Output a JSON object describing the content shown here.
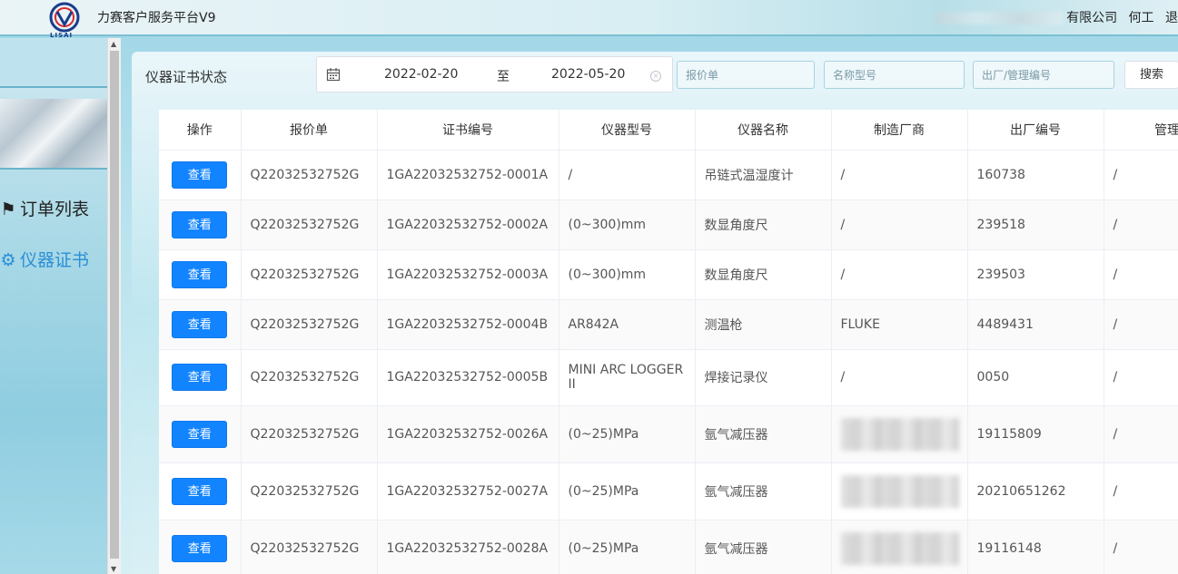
{
  "header": {
    "app_title": "力赛客户服务平台V9",
    "logo_text": "LISAI",
    "company_tail": "有限公司",
    "user": "何工",
    "extra": "退"
  },
  "sidebar": {
    "items": [
      {
        "label": "订单列表",
        "icon": "flag-icon"
      },
      {
        "label": "仪器证书",
        "icon": "gear-icon",
        "active": true
      }
    ]
  },
  "main": {
    "title": "仪器证书状态",
    "date_start": "2022-02-20",
    "date_sep": "至",
    "date_end": "2022-05-20",
    "filters": {
      "quote_placeholder": "报价单",
      "name_placeholder": "名称型号",
      "serial_placeholder": "出厂/管理编号"
    },
    "search_label": "搜索"
  },
  "table": {
    "columns": [
      "操作",
      "报价单",
      "证书编号",
      "仪器型号",
      "仪器名称",
      "制造厂商",
      "出厂编号",
      "管理"
    ],
    "view_label": "查看",
    "rows": [
      {
        "quote": "Q22032532752G",
        "cert": "1GA22032532752-0001A",
        "model": "/",
        "name": "吊链式温湿度计",
        "maker": "/",
        "serial": "160738",
        "mgmt": "/"
      },
      {
        "quote": "Q22032532752G",
        "cert": "1GA22032532752-0002A",
        "model": "(0~300)mm",
        "name": "数显角度尺",
        "maker": "/",
        "serial": "239518",
        "mgmt": "/"
      },
      {
        "quote": "Q22032532752G",
        "cert": "1GA22032532752-0003A",
        "model": "(0~300)mm",
        "name": "数显角度尺",
        "maker": "/",
        "serial": "239503",
        "mgmt": "/"
      },
      {
        "quote": "Q22032532752G",
        "cert": "1GA22032532752-0004B",
        "model": "AR842A",
        "name": "测温枪",
        "maker": "FLUKE",
        "serial": "4489431",
        "mgmt": "/"
      },
      {
        "quote": "Q22032532752G",
        "cert": "1GA22032532752-0005B",
        "model": "MINI ARC LOGGER II",
        "name": "焊接记录仪",
        "maker": "/",
        "serial": "0050",
        "mgmt": "/"
      },
      {
        "quote": "Q22032532752G",
        "cert": "1GA22032532752-0026A",
        "model": "(0~25)MPa",
        "name": "氩气减压器",
        "maker": "",
        "serial": "19115809",
        "mgmt": "/"
      },
      {
        "quote": "Q22032532752G",
        "cert": "1GA22032532752-0027A",
        "model": "(0~25)MPa",
        "name": "氩气减压器",
        "maker": "",
        "serial": "20210651262",
        "mgmt": "/"
      },
      {
        "quote": "Q22032532752G",
        "cert": "1GA22032532752-0028A",
        "model": "(0~25)MPa",
        "name": "氩气减压器",
        "maker": "",
        "serial": "19116148",
        "mgmt": "/"
      }
    ]
  }
}
